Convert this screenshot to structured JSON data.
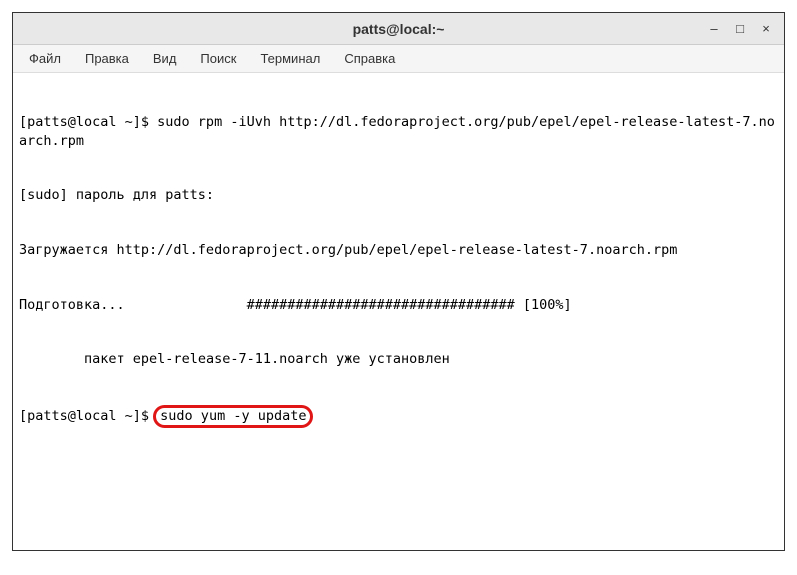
{
  "titlebar": {
    "title": "patts@local:~",
    "minimize": "–",
    "maximize": "□",
    "close": "×"
  },
  "menu": {
    "file": "Файл",
    "edit": "Правка",
    "view": "Вид",
    "search": "Поиск",
    "terminal": "Терминал",
    "help": "Справка"
  },
  "terminal": {
    "line1": "[patts@local ~]$ sudo rpm -iUvh http://dl.fedoraproject.org/pub/epel/epel-release-latest-7.noarch.rpm",
    "line2": "[sudo] пароль для patts:",
    "line3": "Загружается http://dl.fedoraproject.org/pub/epel/epel-release-latest-7.noarch.rpm",
    "line4": "Подготовка...               ################################# [100%]",
    "line5": "        пакет epel-release-7-11.noarch уже установлен",
    "prompt2": "[patts@local ~]$ ",
    "cmd2": "sudo yum -y update"
  }
}
